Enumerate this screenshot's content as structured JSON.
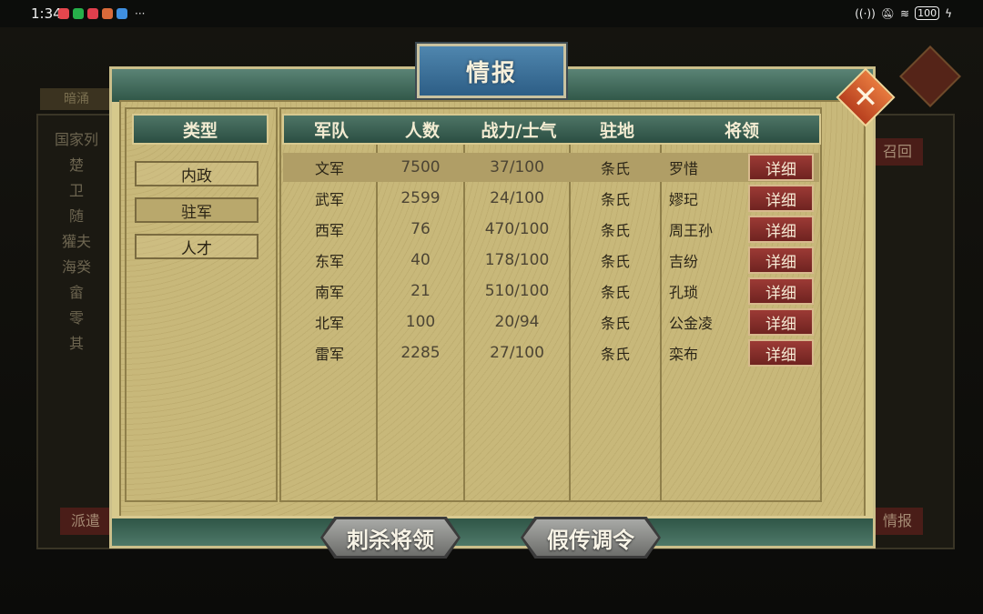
{
  "status_bar": {
    "time": "1:34",
    "dots": "···",
    "battery": "100"
  },
  "background": {
    "tab": "暗涌",
    "left_items": [
      "国家列",
      "楚",
      "卫",
      "随",
      "獾夫",
      "海癸",
      "畲",
      "零",
      "其"
    ],
    "recall_btn": "召回",
    "dispatch_btn": "派遣",
    "intel_btn": "情报"
  },
  "dialog": {
    "title": "情报",
    "type_header": "类型",
    "types": [
      {
        "label": "内政",
        "active": false
      },
      {
        "label": "驻军",
        "active": true
      },
      {
        "label": "人才",
        "active": false
      }
    ],
    "columns": [
      "军队",
      "人数",
      "战力/士气",
      "驻地",
      "将领"
    ],
    "rows": [
      {
        "army": "文军",
        "count": "7500",
        "power": "37/100",
        "station": "条氏",
        "general": "罗惜",
        "detail": "详细"
      },
      {
        "army": "武军",
        "count": "2599",
        "power": "24/100",
        "station": "条氏",
        "general": "嫪玘",
        "detail": "详细"
      },
      {
        "army": "西军",
        "count": "76",
        "power": "470/100",
        "station": "条氏",
        "general": "周王孙",
        "detail": "详细"
      },
      {
        "army": "东军",
        "count": "40",
        "power": "178/100",
        "station": "条氏",
        "general": "吉纷",
        "detail": "详细"
      },
      {
        "army": "南军",
        "count": "21",
        "power": "510/100",
        "station": "条氏",
        "general": "孔琐",
        "detail": "详细"
      },
      {
        "army": "北军",
        "count": "100",
        "power": "20/94",
        "station": "条氏",
        "general": "公金凌",
        "detail": "详细"
      },
      {
        "army": "雷军",
        "count": "2285",
        "power": "27/100",
        "station": "条氏",
        "general": "栾布",
        "detail": "详细"
      }
    ],
    "buttons": {
      "assassinate": "刺杀将领",
      "fake_order": "假传调令"
    }
  }
}
